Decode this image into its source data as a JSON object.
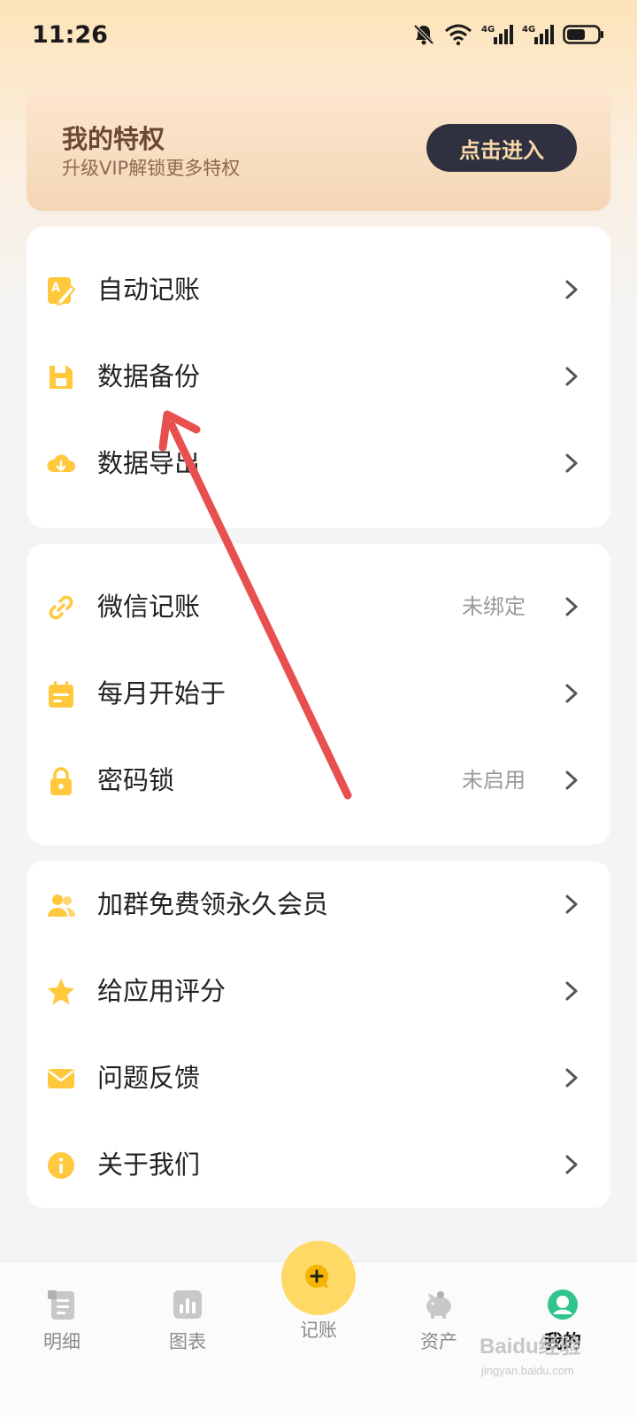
{
  "status_bar": {
    "time": "11:26",
    "icons": [
      "bell-off-icon",
      "wifi-icon",
      "signal-4g-icon",
      "signal-4g-icon",
      "battery-icon"
    ],
    "network_labels": [
      "4G",
      "4G"
    ]
  },
  "vip": {
    "title": "我的特权",
    "subtitle": "升级VIP解锁更多特权",
    "button": "点击进入"
  },
  "group1": [
    {
      "label": "自动记账",
      "icon": "auto-bookkeeping-icon"
    },
    {
      "label": "数据备份",
      "icon": "save-disk-icon"
    },
    {
      "label": "数据导出",
      "icon": "cloud-download-icon"
    }
  ],
  "group2": [
    {
      "label": "微信记账",
      "value": "未绑定",
      "icon": "link-icon"
    },
    {
      "label": "每月开始于",
      "icon": "calendar-icon"
    },
    {
      "label": "密码锁",
      "value": "未启用",
      "icon": "lock-icon"
    }
  ],
  "group3": [
    {
      "label": "加群免费领永久会员",
      "icon": "group-icon"
    },
    {
      "label": "给应用评分",
      "icon": "star-icon"
    },
    {
      "label": "问题反馈",
      "icon": "mail-icon"
    },
    {
      "label": "关于我们",
      "icon": "info-icon"
    }
  ],
  "tab_bar": {
    "tabs": [
      {
        "label": "明细",
        "icon": "list-doc-icon"
      },
      {
        "label": "图表",
        "icon": "chart-icon"
      },
      {
        "label": "记账",
        "icon": "add-icon"
      },
      {
        "label": "资产",
        "icon": "piggy-bank-icon"
      },
      {
        "label": "我的",
        "icon": "profile-icon"
      }
    ],
    "active": "我的"
  },
  "watermark": {
    "brand": "Baidu经验",
    "url": "jingyan.baidu.com"
  },
  "colors": {
    "accent_yellow": "#ffc83d",
    "vip_button_bg": "#2f3140",
    "annotation_arrow": "#e85050"
  }
}
